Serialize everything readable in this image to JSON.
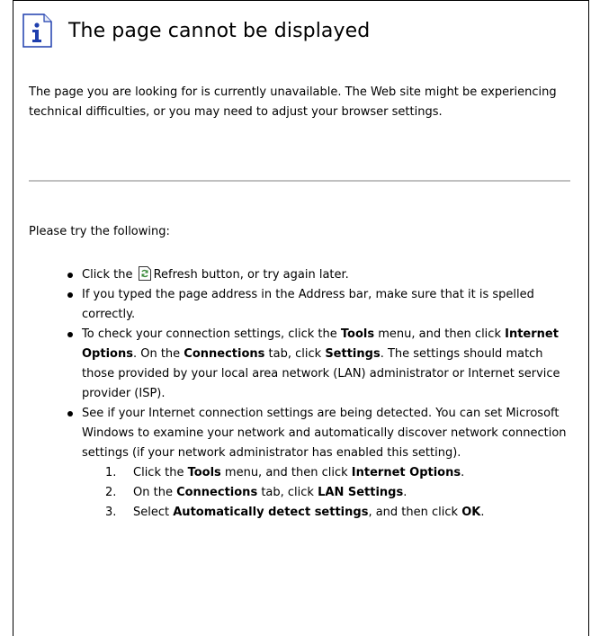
{
  "header": {
    "title": "The page cannot be displayed",
    "icon": "info-icon"
  },
  "intro": {
    "text": "The page you are looking for is currently unavailable. The Web site might be experiencing technical difficulties, or you may need to adjust your browser settings."
  },
  "try_label": "Please try the following:",
  "bullets": {
    "b1_pre": "Click the",
    "b1_post": "Refresh button, or try again later.",
    "b1_icon": "refresh-icon",
    "b2": "If you typed the page address in the Address bar, make sure that it is spelled correctly.",
    "b3": {
      "t1": "To check your connection settings, click the ",
      "tools": "Tools",
      "t2": " menu, and then click ",
      "internet_options": "Internet Options",
      "t3": ". On the ",
      "connections": "Connections",
      "t4": " tab, click ",
      "settings": "Settings",
      "t5": ". The settings should match those provided by your local area network (LAN) administrator or Internet service provider (ISP)."
    },
    "b4": {
      "text": "See if your Internet connection settings are being detected. You can set Microsoft Windows to examine your network and automatically discover network connection settings (if your network administrator has enabled this setting).",
      "steps": [
        {
          "num": "1.",
          "t1": "Click the ",
          "b1": "Tools",
          "t2": " menu, and then click ",
          "b2": "Internet Options",
          "t3": "."
        },
        {
          "num": "2.",
          "t1": "On the ",
          "b1": "Connections",
          "t2": " tab, click ",
          "b2": "LAN Settings",
          "t3": "."
        },
        {
          "num": "3.",
          "t1": "Select ",
          "b1": "Automatically detect settings",
          "t2": ", and then click ",
          "b2": "OK",
          "t3": "."
        }
      ]
    }
  },
  "colors": {
    "divider": "#c0c0c0",
    "icon_blue": "#1f3fae",
    "border": "#000000"
  }
}
